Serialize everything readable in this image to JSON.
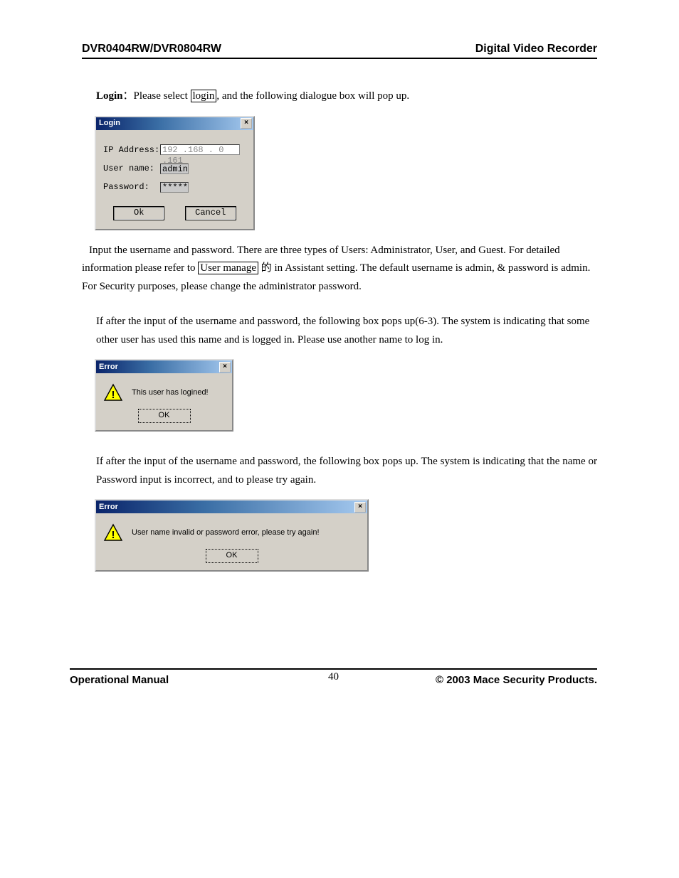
{
  "header": {
    "left": "DVR0404RW/DVR0804RW",
    "right": "Digital Video Recorder"
  },
  "body": {
    "login_intro": {
      "bold": "Login",
      "sep": "：",
      "t1": "Please select ",
      "boxed": "login",
      "t2": ", and the following dialogue box will pop up."
    },
    "login_dialog": {
      "title": "Login",
      "rows": {
        "ip_label": "IP Address:",
        "ip_value": "192 .168 . 0  .161",
        "user_label": "User name:",
        "user_value": "admin",
        "pass_label": "Password:",
        "pass_value": "*****"
      },
      "ok": "Ok",
      "cancel": "Cancel"
    },
    "para2": {
      "t1": "Input the username and password. There are three types of Users: Administrator, User, and Guest. For detailed information please refer to ",
      "boxed": "User manage",
      "t2": "的 in Assistant setting. The default username is admin, & password is admin. For Security purposes, please change the administrator password."
    },
    "para3": "If after the input of the username and password, the following box pops up(6-3). The system is indicating that some other user has used this name and is logged in. Please use another name to log in.",
    "error1": {
      "title": "Error",
      "msg": "This user has logined!",
      "ok": "OK"
    },
    "para4": "If after the input of the username and password, the following box pops up. The system is indicating that the name or Password input is incorrect, and to please try again.",
    "error2": {
      "title": "Error",
      "msg": "User name invalid or password error, please try again!",
      "ok": "OK"
    }
  },
  "footer": {
    "left": "Operational Manual",
    "page": "40",
    "right": "© 2003 Mace Security Products."
  }
}
